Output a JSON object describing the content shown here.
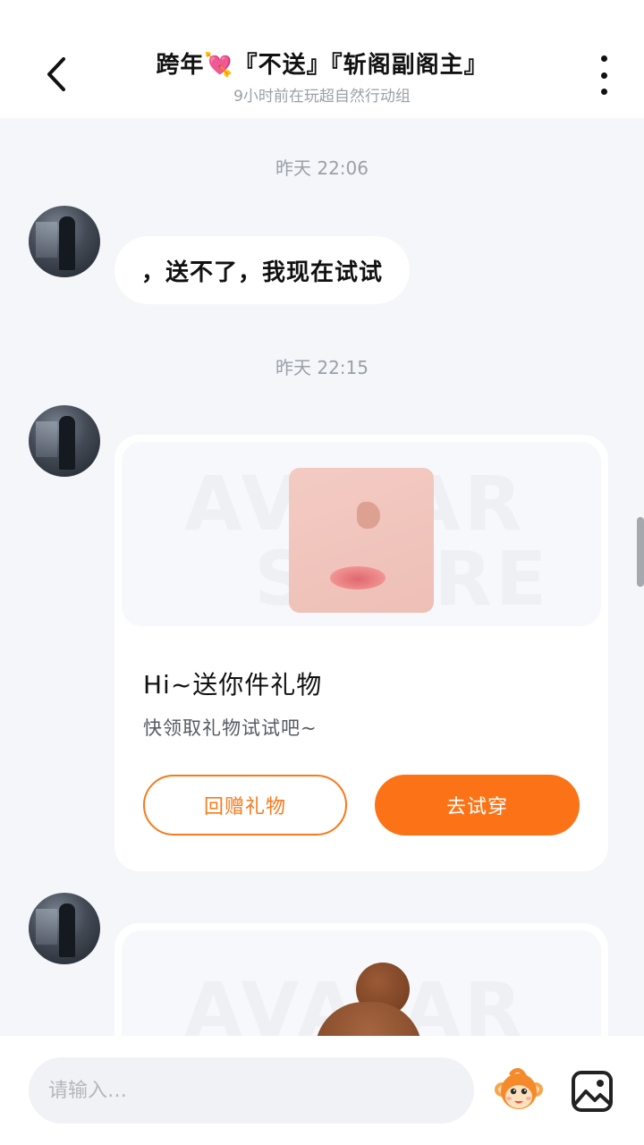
{
  "header": {
    "title": "跨年💘『不送』『斩阁副阁主』",
    "subtitle": "9小时前在玩超自然行动组"
  },
  "messages": [
    {
      "timestamp": "昨天 22:06",
      "text": "，送不了，我现在试试"
    },
    {
      "timestamp": "昨天 22:15",
      "gift": {
        "watermark_top": "AVATAR",
        "watermark_bottom": "STORE",
        "title": "Hi~送你件礼物",
        "description": "快领取礼物试试吧~",
        "return_button": "回赠礼物",
        "try_button": "去试穿"
      }
    },
    {
      "gift": {
        "watermark_top": "AVATAR"
      }
    }
  ],
  "input": {
    "placeholder": "请输入…"
  },
  "icons": {
    "back": "chevron-left-icon",
    "more": "more-vertical-icon",
    "mascot": "monkey-mascot-icon",
    "image": "image-icon"
  },
  "colors": {
    "accent": "#fb7316",
    "background": "#f4f6fa",
    "card": "#ffffff",
    "muted_text": "#9aa0a8"
  }
}
